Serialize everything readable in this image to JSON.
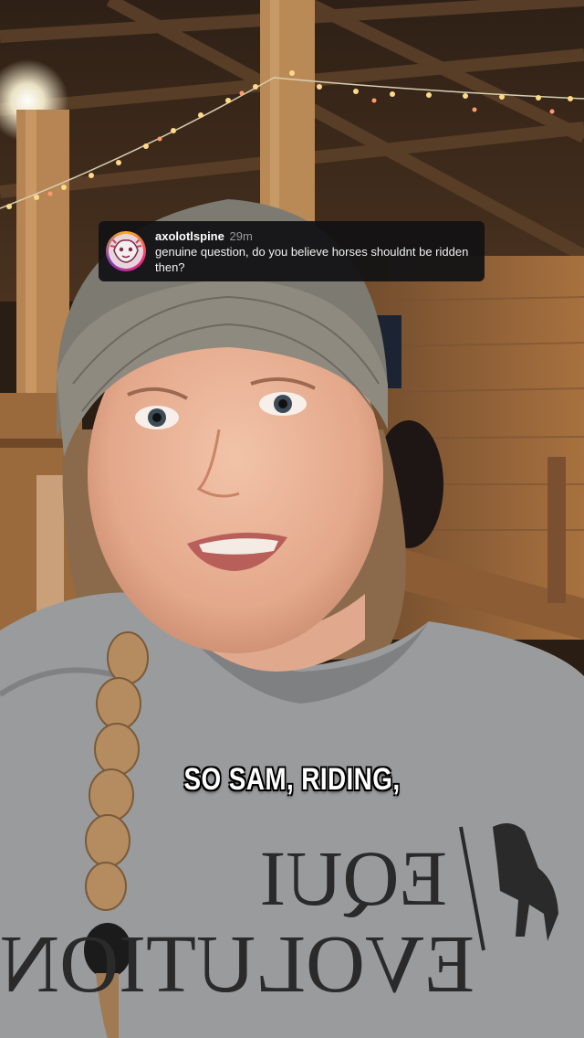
{
  "comment_reply": {
    "username": "axolotlspine",
    "time": "29m",
    "text": "genuine question, do you believe horses shouldnt be ridden then?",
    "avatar_icon": "avatar-illustration-icon"
  },
  "caption": {
    "text": "SO SAM, RIDING,"
  },
  "shirt_print": {
    "text_top": "EQUI",
    "text_bottom": "EVOLUTION",
    "logo_icon": "horse-silhouette-icon"
  },
  "colors": {
    "card_bg": "#121214",
    "caption_fill": "#ffffff",
    "caption_stroke": "#000000",
    "wood": "#b07a48",
    "hoodie": "#9a9b9d"
  }
}
